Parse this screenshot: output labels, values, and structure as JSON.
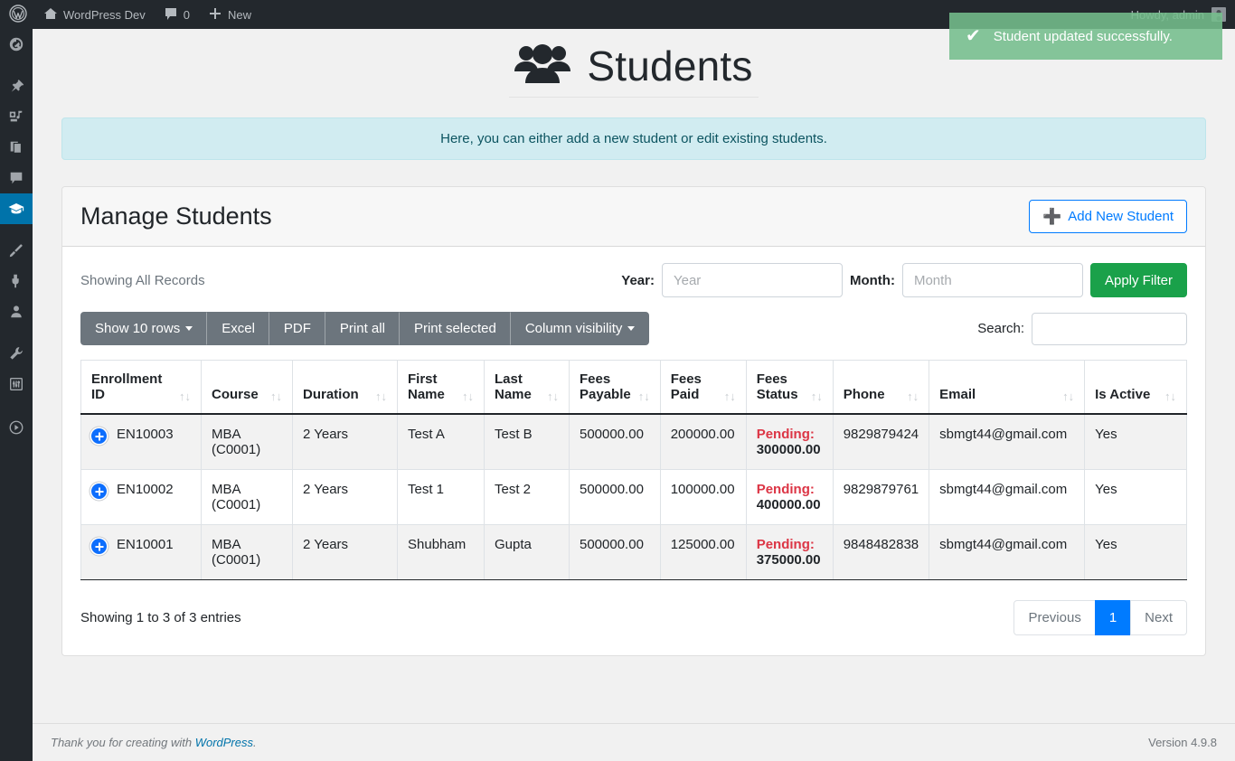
{
  "adminbar": {
    "logo_icon": "wordpress-logo-icon",
    "site_icon": "home-icon",
    "site_name": "WordPress Dev",
    "comments_icon": "comment-bubble-icon",
    "comments_count": "0",
    "new_icon": "plus-icon",
    "new_label": "New",
    "howdy": "Howdy, admin",
    "avatar_icon": "user-avatar-icon"
  },
  "sidebar": {
    "items": [
      {
        "name": "dashboard",
        "icon": "dashboard-gauge-icon",
        "active": false
      },
      {
        "name": "posts",
        "icon": "pushpin-icon",
        "active": false
      },
      {
        "name": "media",
        "icon": "media-camera-music-icon",
        "active": false
      },
      {
        "name": "pages",
        "icon": "pages-icon",
        "active": false
      },
      {
        "name": "comments",
        "icon": "comment-bubble-icon",
        "active": false
      },
      {
        "name": "students",
        "icon": "graduation-cap-icon",
        "active": true
      },
      {
        "name": "appearance",
        "icon": "paint-brush-icon",
        "active": false
      },
      {
        "name": "plugins",
        "icon": "plug-icon",
        "active": false
      },
      {
        "name": "users",
        "icon": "user-icon",
        "active": false
      },
      {
        "name": "tools",
        "icon": "wrench-icon",
        "active": false
      },
      {
        "name": "settings",
        "icon": "sliders-icon",
        "active": false
      },
      {
        "name": "collapse-menu",
        "icon": "collapse-arrow-icon",
        "active": false
      }
    ]
  },
  "toast": {
    "icon": "checkmark-icon",
    "message": "Student updated successfully.",
    "color": "#74bd8c"
  },
  "page": {
    "icon": "group-of-people-icon",
    "title": "Students",
    "info_alert": "Here, you can either add a new student or edit existing students."
  },
  "card": {
    "title": "Manage Students",
    "add_button": "Add New Student",
    "add_button_icon": "plus-icon",
    "add_button_color": "#007bff"
  },
  "filter": {
    "showing_records": "Showing All Records",
    "year_label": "Year:",
    "year_value": "",
    "year_placeholder": "Year",
    "month_label": "Month:",
    "month_value": "",
    "month_placeholder": "Month",
    "apply_label": "Apply Filter",
    "apply_color": "#1aa14a"
  },
  "toolbar": {
    "buttons": [
      {
        "label": "Show 10 rows",
        "caret": true
      },
      {
        "label": "Excel",
        "caret": false
      },
      {
        "label": "PDF",
        "caret": false
      },
      {
        "label": "Print all",
        "caret": false
      },
      {
        "label": "Print selected",
        "caret": false
      },
      {
        "label": "Column visibility",
        "caret": true
      }
    ],
    "search_label": "Search:",
    "search_value": "",
    "search_placeholder": ""
  },
  "table": {
    "columns": [
      "Enrollment ID",
      "Course",
      "Duration",
      "First Name",
      "Last Name",
      "Fees Payable",
      "Fees Paid",
      "Fees Status",
      "Phone",
      "Email",
      "Is Active"
    ],
    "sort_glyph": "↑↓",
    "rows": [
      {
        "enrollment_id": "EN10003",
        "course": "MBA (C0001)",
        "duration": "2 Years",
        "first_name": "Test A",
        "last_name": "Test B",
        "fees_payable": "500000.00",
        "fees_paid": "200000.00",
        "fees_status_label": "Pending:",
        "fees_status_amount": "300000.00",
        "phone": "9829879424",
        "email": "sbmgt44@gmail.com",
        "is_active": "Yes"
      },
      {
        "enrollment_id": "EN10002",
        "course": "MBA (C0001)",
        "duration": "2 Years",
        "first_name": "Test 1",
        "last_name": "Test 2",
        "fees_payable": "500000.00",
        "fees_paid": "100000.00",
        "fees_status_label": "Pending:",
        "fees_status_amount": "400000.00",
        "phone": "9829879761",
        "email": "sbmgt44@gmail.com",
        "is_active": "Yes"
      },
      {
        "enrollment_id": "EN10001",
        "course": "MBA (C0001)",
        "duration": "2 Years",
        "first_name": "Shubham",
        "last_name": "Gupta",
        "fees_payable": "500000.00",
        "fees_paid": "125000.00",
        "fees_status_label": "Pending:",
        "fees_status_amount": "375000.00",
        "phone": "9848482838",
        "email": "sbmgt44@gmail.com",
        "is_active": "Yes"
      }
    ],
    "info": "Showing 1 to 3 of 3 entries",
    "pagination": {
      "previous": "Previous",
      "pages": [
        "1"
      ],
      "next": "Next",
      "active_page": "1",
      "active_color": "#007bff"
    }
  },
  "footer": {
    "thanks_prefix": "Thank you for creating with ",
    "thanks_link": "WordPress",
    "thanks_suffix": ".",
    "version": "Version 4.9.8"
  }
}
